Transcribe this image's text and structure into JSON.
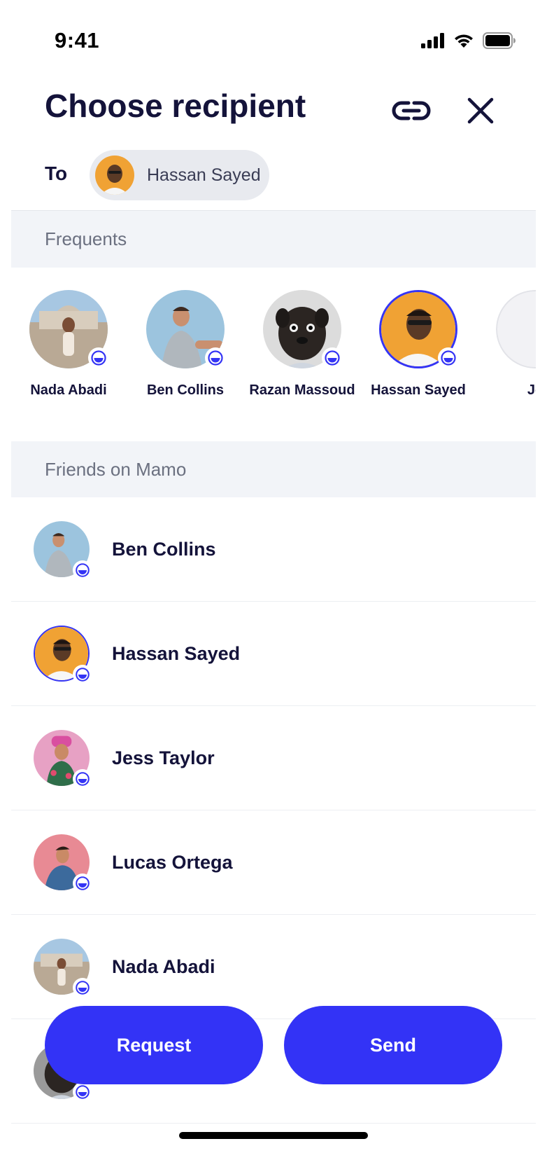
{
  "status_bar": {
    "time": "9:41",
    "icons": [
      "cellular-signal-icon",
      "wifi-icon",
      "battery-icon"
    ]
  },
  "header": {
    "title": "Choose recipient",
    "link_icon": "link-icon",
    "close_icon": "close-icon",
    "to_label": "To",
    "selected_recipient": {
      "name": "Hassan Sayed",
      "avatar_color": "#f0a234"
    }
  },
  "frequents": {
    "section_title": "Frequents",
    "items": [
      {
        "name": "Nada Abadi",
        "avatar_color": "#b8a99a",
        "selected": false
      },
      {
        "name": "Ben Collins",
        "avatar_color": "#9cc4de",
        "selected": false
      },
      {
        "name": "Razan Massoud",
        "avatar_color": "#d9d9d9",
        "selected": false
      },
      {
        "name": "Hassan Sayed",
        "avatar_color": "#f0a234",
        "selected": true
      },
      {
        "name": "Je",
        "avatar_color": "#f2f2f5",
        "selected": false
      }
    ]
  },
  "friends": {
    "section_title": "Friends on Mamo",
    "items": [
      {
        "name": "Ben Collins",
        "avatar_color": "#9cc4de",
        "selected": false
      },
      {
        "name": "Hassan Sayed",
        "avatar_color": "#f0a234",
        "selected": true
      },
      {
        "name": "Jess Taylor",
        "avatar_color": "#e7a1c4",
        "selected": false
      },
      {
        "name": "Lucas Ortega",
        "avatar_color": "#e88a94",
        "selected": false
      },
      {
        "name": "Nada Abadi",
        "avatar_color": "#b8a99a",
        "selected": false
      },
      {
        "name": "",
        "avatar_color": "#8a8a8a",
        "selected": false
      }
    ]
  },
  "actions": {
    "request_label": "Request",
    "send_label": "Send"
  },
  "colors": {
    "accent": "#3333f6",
    "text": "#14133a",
    "section_bg": "#f2f4f8"
  }
}
